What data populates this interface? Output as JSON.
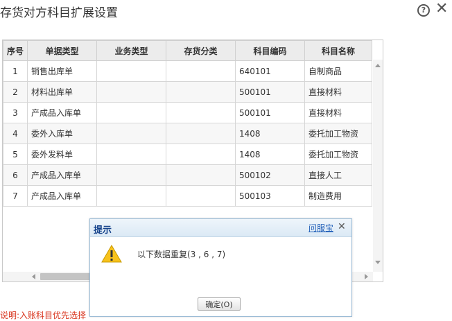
{
  "window": {
    "title": "存货对方科目扩展设置"
  },
  "table": {
    "headers": [
      "序号",
      "单据类型",
      "业务类型",
      "存货分类",
      "科目编码",
      "科目名称"
    ],
    "rows": [
      [
        "1",
        "销售出库单",
        "",
        "",
        "640101",
        "自制商品"
      ],
      [
        "2",
        "材料出库单",
        "",
        "",
        "500101",
        "直接材料"
      ],
      [
        "3",
        "产成品入库单",
        "",
        "",
        "500101",
        "直接材料"
      ],
      [
        "4",
        "委外入库单",
        "",
        "",
        "1408",
        "委托加工物资"
      ],
      [
        "5",
        "委外发料单",
        "",
        "",
        "1408",
        "委托加工物资"
      ],
      [
        "6",
        "产成品入库单",
        "",
        "",
        "500102",
        "直接人工"
      ],
      [
        "7",
        "产成品入库单",
        "",
        "",
        "500103",
        "制造费用"
      ]
    ]
  },
  "note": "说明:入账科目优先选择",
  "dialog": {
    "title": "提示",
    "link": "问服宝",
    "message": "以下数据重复(3 , 6 , 7)",
    "ok_label": "确定(O)"
  },
  "colors": {
    "accent": "#15428b",
    "warning": "#f7c21c",
    "note_red": "#d9361f"
  }
}
